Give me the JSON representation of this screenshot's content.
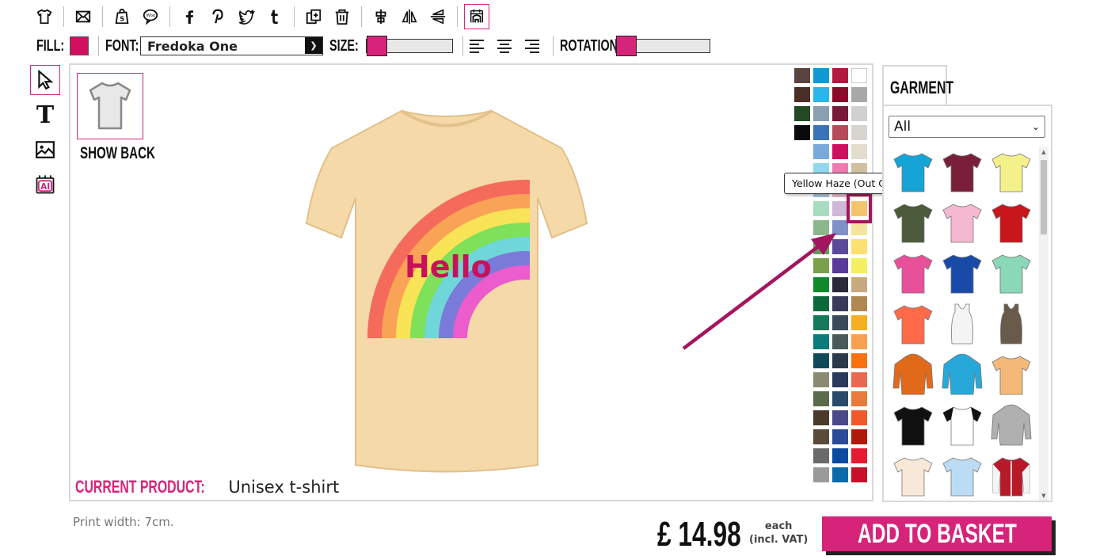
{
  "toolbar": {
    "fill_label": "FILL:",
    "fill_color": "#d0105f",
    "font_label": "FONT:",
    "font_value": "Fredoka One",
    "size_label": "SIZE:",
    "rotation_label": "ROTATION:",
    "accent": "#d6247a"
  },
  "canvas": {
    "show_back_label": "SHOW BACK",
    "design_text": "Hello",
    "current_product_label": "CURRENT PRODUCT:",
    "current_product_value": "Unisex t-shirt",
    "shirt_color": "#f5d9a8"
  },
  "colors": {
    "tooltip": "Yellow Haze (Out Of Stock)",
    "selected": "#f4c46c"
  },
  "garment": {
    "tab_label": "GARMENT",
    "filter_value": "All"
  },
  "footer": {
    "print_width": "Print width: 7cm.",
    "price": "£ 14.98",
    "each": "each",
    "vat": "(incl. VAT)",
    "add_to_basket": "ADD TO BASKET"
  }
}
